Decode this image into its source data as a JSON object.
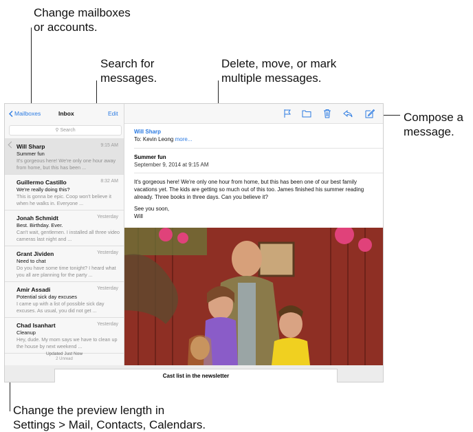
{
  "callouts": {
    "mailboxes": "Change mailboxes\nor accounts.",
    "search": "Search for\nmessages.",
    "delete": "Delete, move, or mark\nmultiple messages.",
    "compose": "Compose a\nmessage.",
    "preview": "Change the preview length in\nSettings > Mail, Contacts, Calendars."
  },
  "sidebar": {
    "back_label": "Mailboxes",
    "title": "Inbox",
    "edit_label": "Edit",
    "search_placeholder": "Search",
    "messages": [
      {
        "from": "Will Sharp",
        "time": "9:15 AM",
        "subject": "Summer fun",
        "preview": "It's gorgeous here! We're only one hour away from home, but this has been ..."
      },
      {
        "from": "Guillermo Castillo",
        "time": "8:32 AM",
        "subject": "We're really doing this?",
        "preview": "This is gonna be epic. Coop won't believe it when he walks in. Everyone ..."
      },
      {
        "from": "Jonah Schmidt",
        "time": "Yesterday",
        "subject": "Best. Birthday. Ever.",
        "preview": "Can't wait, gentlemen. I installed all three video cameras last night and ..."
      },
      {
        "from": "Grant Jividen",
        "time": "Yesterday",
        "subject": "Need to chat",
        "preview": "Do you have some time tonight? I heard what you all are planning for the party ..."
      },
      {
        "from": "Amir Assadi",
        "time": "Yesterday",
        "subject": "Potential sick day excuses",
        "preview": "I came up with a list of possible sick day excuses. As usual, you did not get ..."
      },
      {
        "from": "Chad Isanhart",
        "time": "Yesterday",
        "subject": "Cleanup",
        "preview": "Hey, dude. My mom says we have to clean up the house by next weekend ..."
      }
    ],
    "updated": "Updated Just Now",
    "unread": "2 Unread"
  },
  "detail": {
    "sender": "Will Sharp",
    "to_label": "To: Kevin Leong",
    "more_label": "more...",
    "subject": "Summer fun",
    "date": "September 9, 2014 at 9:15 AM",
    "body_para": "It's gorgeous here! We're only one hour from home, but this has been one of our best family vacations yet. The kids are getting so much out of this too. James finished his summer reading already. Three books in three days. Can you believe it?",
    "signoff": "See you soon,",
    "signature": "Will",
    "toolbar_icons": [
      "flag-icon",
      "folder-icon",
      "trash-icon",
      "reply-icon",
      "compose-icon"
    ]
  },
  "popup_label": "Cast list in the newsletter",
  "colors": {
    "accent": "#2a7ae2",
    "barn_red": "#9a3428",
    "flowers": "#e0427a"
  }
}
